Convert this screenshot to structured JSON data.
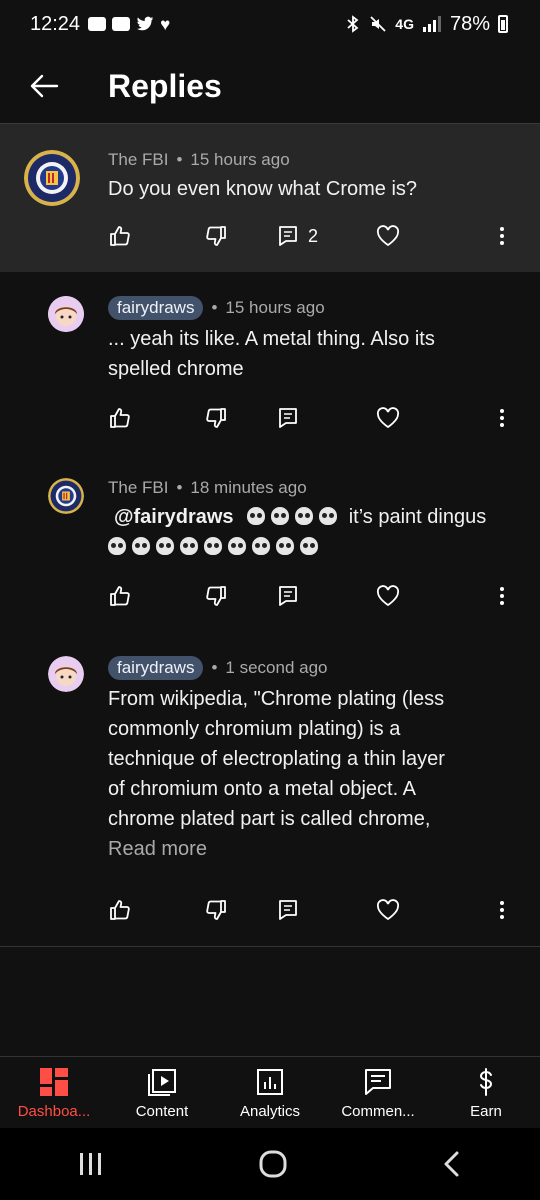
{
  "status_bar": {
    "time": "12:24",
    "network": "4G",
    "battery": "78%"
  },
  "header": {
    "title": "Replies"
  },
  "comments": [
    {
      "author": "The FBI",
      "time": "15 hours ago",
      "text": "Do you even know what Crome is?",
      "reply_count": "2"
    },
    {
      "author": "fairydraws",
      "time": "15 hours ago",
      "text_line1": "... yeah its like. A metal thing. Also its",
      "text_line2": "spelled chrome"
    },
    {
      "author": "The FBI",
      "time": "18 minutes ago",
      "mention": "@fairydraws",
      "text": "it’s paint dingus"
    },
    {
      "author": "fairydraws",
      "time": "1 second ago",
      "lines": [
        "From wikipedia, \"Chrome plating (less",
        "commonly chromium plating) is a",
        "technique of electroplating a thin layer",
        "of chromium onto a metal object. A",
        "chrome plated part is called chrome,"
      ],
      "read_more": "Read more"
    }
  ],
  "meta_separator": "•",
  "bottom_nav": [
    {
      "label": "Dashboa...",
      "icon": "dashboard-icon",
      "active": true
    },
    {
      "label": "Content",
      "icon": "content-icon"
    },
    {
      "label": "Analytics",
      "icon": "analytics-icon"
    },
    {
      "label": "Commen...",
      "icon": "comments-icon"
    },
    {
      "label": "Earn",
      "icon": "earn-icon"
    }
  ],
  "colors": {
    "accent": "#ff4e45",
    "chip": "#42526a",
    "highlight_bg": "#272727"
  }
}
